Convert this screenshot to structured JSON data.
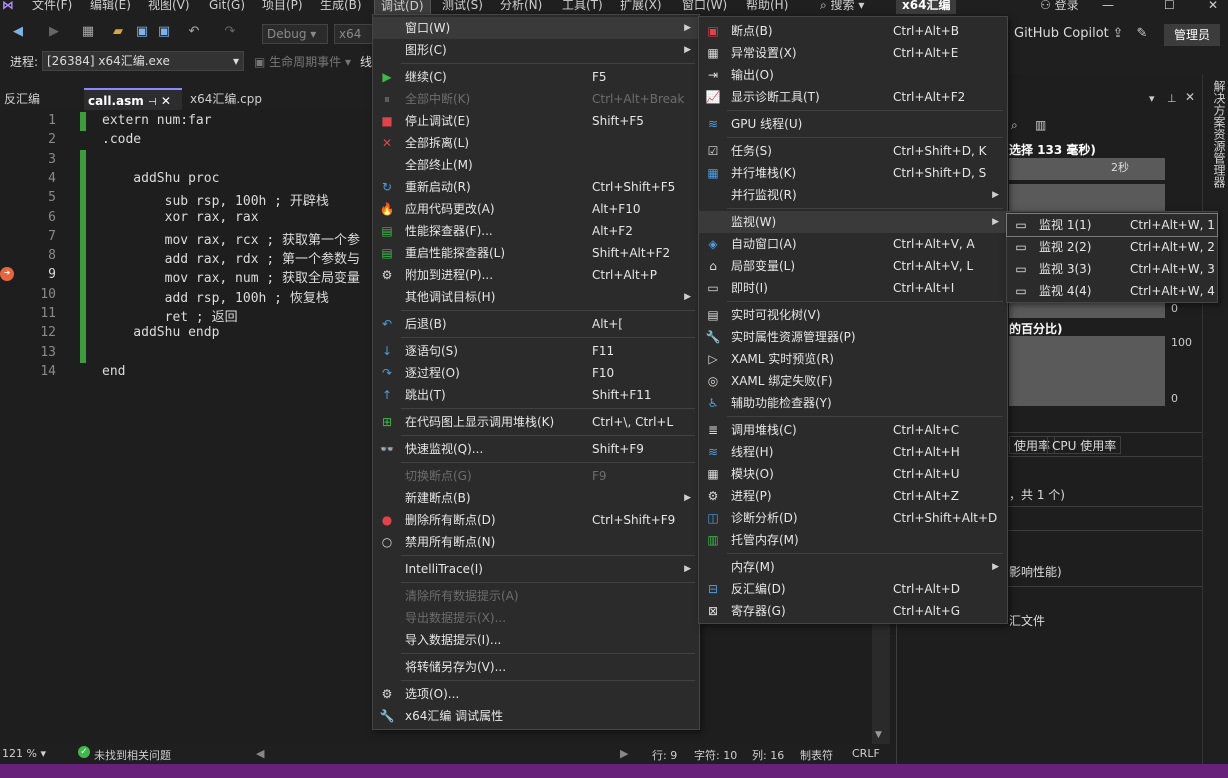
{
  "menubar": {
    "items": [
      "文件(F)",
      "编辑(E)",
      "视图(V)",
      "Git(G)",
      "项目(P)",
      "生成(B)",
      "调试(D)",
      "测试(S)",
      "分析(N)",
      "工具(T)",
      "扩展(X)",
      "窗口(W)",
      "帮助(H)"
    ],
    "search": "搜索",
    "solution": "x64汇编",
    "login": "登录",
    "copilot": "GitHub Copilot",
    "admin": "管理员"
  },
  "toolbar": {
    "config": "Debug",
    "platform": "x64",
    "process_label": "进程:",
    "process": "[26384] x64汇编.exe",
    "lifecycle": "生命周期事件",
    "thread": "线"
  },
  "tabs": {
    "disasm": "反汇编",
    "call": "call.asm",
    "cpp": "x64汇编.cpp"
  },
  "editor": {
    "lines": [
      {
        "n": "1",
        "t": "extern num:far"
      },
      {
        "n": "2",
        "t": ".code"
      },
      {
        "n": "3",
        "t": ""
      },
      {
        "n": "4",
        "t": "    addShu proc"
      },
      {
        "n": "5",
        "t": "        sub rsp, 100h ; 开辟栈"
      },
      {
        "n": "6",
        "t": "        xor rax, rax"
      },
      {
        "n": "7",
        "t": "        mov rax, rcx ; 获取第一个参"
      },
      {
        "n": "8",
        "t": "        add rax, rdx ; 第一个参数与"
      },
      {
        "n": "9",
        "t": "        mov rax, num ; 获取全局变量"
      },
      {
        "n": "10",
        "t": "        add rsp, 100h ; 恢复栈"
      },
      {
        "n": "11",
        "t": "        ret ; 返回"
      },
      {
        "n": "12",
        "t": "    addShu endp"
      },
      {
        "n": "13",
        "t": ""
      },
      {
        "n": "14",
        "t": "end"
      }
    ]
  },
  "debug_menu": {
    "items": [
      {
        "icon": "",
        "label": "窗口(W)",
        "shortcut": "",
        "sub": true,
        "hl": true
      },
      {
        "icon": "",
        "label": "图形(C)",
        "shortcut": "",
        "sub": true
      },
      {
        "sep": true
      },
      {
        "icon": "▶",
        "label": "继续(C)",
        "shortcut": "F5",
        "color": "#3fb94a"
      },
      {
        "icon": "⏸",
        "label": "全部中断(K)",
        "shortcut": "Ctrl+Alt+Break",
        "disabled": true
      },
      {
        "icon": "■",
        "label": "停止调试(E)",
        "shortcut": "Shift+F5",
        "color": "#e0434b"
      },
      {
        "icon": "✕",
        "label": "全部拆离(L)",
        "shortcut": "",
        "color": "#e0434b"
      },
      {
        "icon": "",
        "label": "全部终止(M)",
        "shortcut": ""
      },
      {
        "icon": "↻",
        "label": "重新启动(R)",
        "shortcut": "Ctrl+Shift+F5",
        "color": "#4d9de0"
      },
      {
        "icon": "🔥",
        "label": "应用代码更改(A)",
        "shortcut": "Alt+F10",
        "color": "#e8663d"
      },
      {
        "icon": "▤",
        "label": "性能探查器(F)...",
        "shortcut": "Alt+F2",
        "color": "#3fb94a"
      },
      {
        "icon": "▤",
        "label": "重启性能探查器(L)",
        "shortcut": "Shift+Alt+F2",
        "color": "#3fb94a"
      },
      {
        "icon": "⚙",
        "label": "附加到进程(P)...",
        "shortcut": "Ctrl+Alt+P",
        "color": "#dcdcdc"
      },
      {
        "icon": "",
        "label": "其他调试目标(H)",
        "shortcut": "",
        "sub": true
      },
      {
        "sep": true
      },
      {
        "icon": "↶",
        "label": "后退(B)",
        "shortcut": "Alt+[",
        "color": "#4d9de0"
      },
      {
        "sep": true
      },
      {
        "icon": "↓",
        "label": "逐语句(S)",
        "shortcut": "F11",
        "color": "#4d9de0"
      },
      {
        "icon": "↷",
        "label": "逐过程(O)",
        "shortcut": "F10",
        "color": "#4d9de0"
      },
      {
        "icon": "↑",
        "label": "跳出(T)",
        "shortcut": "Shift+F11",
        "color": "#4d9de0"
      },
      {
        "sep": true
      },
      {
        "icon": "⊞",
        "label": "在代码图上显示调用堆栈(K)",
        "shortcut": "Ctrl+\\, Ctrl+L",
        "color": "#3fb94a"
      },
      {
        "sep": true
      },
      {
        "icon": "👓",
        "label": "快速监视(Q)...",
        "shortcut": "Shift+F9",
        "color": "#dcdcdc"
      },
      {
        "sep": true
      },
      {
        "icon": "",
        "label": "切换断点(G)",
        "shortcut": "F9",
        "disabled": true
      },
      {
        "icon": "",
        "label": "新建断点(B)",
        "shortcut": "",
        "sub": true
      },
      {
        "icon": "●",
        "label": "删除所有断点(D)",
        "shortcut": "Ctrl+Shift+F9",
        "color": "#e0434b"
      },
      {
        "icon": "○",
        "label": "禁用所有断点(N)",
        "shortcut": "",
        "color": "#dcdcdc"
      },
      {
        "sep": true
      },
      {
        "icon": "",
        "label": "IntelliTrace(I)",
        "shortcut": "",
        "sub": true
      },
      {
        "sep": true
      },
      {
        "icon": "",
        "label": "清除所有数据提示(A)",
        "shortcut": "",
        "disabled": true
      },
      {
        "icon": "",
        "label": "导出数据提示(X)...",
        "shortcut": "",
        "disabled": true
      },
      {
        "icon": "",
        "label": "导入数据提示(I)...",
        "shortcut": ""
      },
      {
        "sep": true
      },
      {
        "icon": "",
        "label": "将转储另存为(V)...",
        "shortcut": ""
      },
      {
        "sep": true
      },
      {
        "icon": "⚙",
        "label": "选项(O)...",
        "shortcut": "",
        "color": "#dcdcdc"
      },
      {
        "icon": "🔧",
        "label": "x64汇编 调试属性",
        "shortcut": "",
        "color": "#dcdcdc"
      }
    ]
  },
  "window_menu": {
    "items": [
      {
        "icon": "▣",
        "label": "断点(B)",
        "shortcut": "Ctrl+Alt+B",
        "color": "#e0434b"
      },
      {
        "icon": "▦",
        "label": "异常设置(X)",
        "shortcut": "Ctrl+Alt+E",
        "color": "#dcdcdc"
      },
      {
        "icon": "⇥",
        "label": "输出(O)",
        "shortcut": "",
        "color": "#dcdcdc"
      },
      {
        "icon": "📈",
        "label": "显示诊断工具(T)",
        "shortcut": "Ctrl+Alt+F2",
        "color": "#3fb94a"
      },
      {
        "sep": true
      },
      {
        "icon": "≋",
        "label": "GPU 线程(U)",
        "shortcut": "",
        "color": "#4d9de0"
      },
      {
        "sep": true
      },
      {
        "icon": "☑",
        "label": "任务(S)",
        "shortcut": "Ctrl+Shift+D, K",
        "color": "#dcdcdc"
      },
      {
        "icon": "▦",
        "label": "并行堆栈(K)",
        "shortcut": "Ctrl+Shift+D, S",
        "color": "#4d9de0"
      },
      {
        "icon": "",
        "label": "并行监视(R)",
        "shortcut": "",
        "sub": true
      },
      {
        "sep": true
      },
      {
        "icon": "",
        "label": "监视(W)",
        "shortcut": "",
        "sub": true,
        "hl": true
      },
      {
        "icon": "◈",
        "label": "自动窗口(A)",
        "shortcut": "Ctrl+Alt+V, A",
        "color": "#4d9de0"
      },
      {
        "icon": "⌂",
        "label": "局部变量(L)",
        "shortcut": "Ctrl+Alt+V, L",
        "color": "#dcdcdc"
      },
      {
        "icon": "▭",
        "label": "即时(I)",
        "shortcut": "Ctrl+Alt+I",
        "color": "#dcdcdc"
      },
      {
        "sep": true
      },
      {
        "icon": "▤",
        "label": "实时可视化树(V)",
        "shortcut": "",
        "color": "#dcdcdc"
      },
      {
        "icon": "🔧",
        "label": "实时属性资源管理器(P)",
        "shortcut": "",
        "color": "#dcdcdc"
      },
      {
        "icon": "▷",
        "label": "XAML 实时预览(R)",
        "shortcut": "",
        "color": "#dcdcdc"
      },
      {
        "icon": "◎",
        "label": "XAML 绑定失败(F)",
        "shortcut": "",
        "color": "#dcdcdc"
      },
      {
        "icon": "♿",
        "label": "辅助功能检查器(Y)",
        "shortcut": "",
        "color": "#4d9de0"
      },
      {
        "sep": true
      },
      {
        "icon": "≣",
        "label": "调用堆栈(C)",
        "shortcut": "Ctrl+Alt+C",
        "color": "#dcdcdc"
      },
      {
        "icon": "≋",
        "label": "线程(H)",
        "shortcut": "Ctrl+Alt+H",
        "color": "#4d9de0"
      },
      {
        "icon": "▦",
        "label": "模块(O)",
        "shortcut": "Ctrl+Alt+U",
        "color": "#dcdcdc"
      },
      {
        "icon": "⚙",
        "label": "进程(P)",
        "shortcut": "Ctrl+Alt+Z",
        "color": "#dcdcdc"
      },
      {
        "icon": "◫",
        "label": "诊断分析(D)",
        "shortcut": "Ctrl+Shift+Alt+D",
        "color": "#4d9de0"
      },
      {
        "icon": "▥",
        "label": "托管内存(M)",
        "shortcut": "",
        "color": "#3fb94a"
      },
      {
        "sep": true
      },
      {
        "icon": "",
        "label": "内存(M)",
        "shortcut": "",
        "sub": true
      },
      {
        "icon": "⊟",
        "label": "反汇编(D)",
        "shortcut": "Ctrl+Alt+D",
        "color": "#4d9de0"
      },
      {
        "icon": "⊠",
        "label": "寄存器(G)",
        "shortcut": "Ctrl+Alt+G",
        "color": "#dcdcdc"
      }
    ]
  },
  "watch_menu": {
    "items": [
      {
        "icon": "▭",
        "label": "监视 1(1)",
        "shortcut": "Ctrl+Alt+W, 1"
      },
      {
        "icon": "▭",
        "label": "监视 2(2)",
        "shortcut": "Ctrl+Alt+W, 2"
      },
      {
        "icon": "▭",
        "label": "监视 3(3)",
        "shortcut": "Ctrl+Alt+W, 3"
      },
      {
        "icon": "▭",
        "label": "监视 4(4)",
        "shortcut": "Ctrl+Alt+W, 4"
      }
    ]
  },
  "diag": {
    "title_partial": "选择 133 毫秒)",
    "timer": "2秒",
    "zero1": "0",
    "cpu_title": "的百分比)",
    "hundred": "100",
    "zero2": "0",
    "tab_mem": "使用率",
    "tab_cpu": "CPU 使用率",
    "events": "，共 1 个)",
    "perf": "影响性能)",
    "file": "汇文件"
  },
  "side": {
    "title": "解决方案资源管理器"
  },
  "status": {
    "zoom": "121 %",
    "issues": "未找到相关问题",
    "row": "行: 9",
    "col": "字符: 10",
    "pos": "列: 16",
    "tab": "制表符",
    "eol": "CRLF"
  }
}
